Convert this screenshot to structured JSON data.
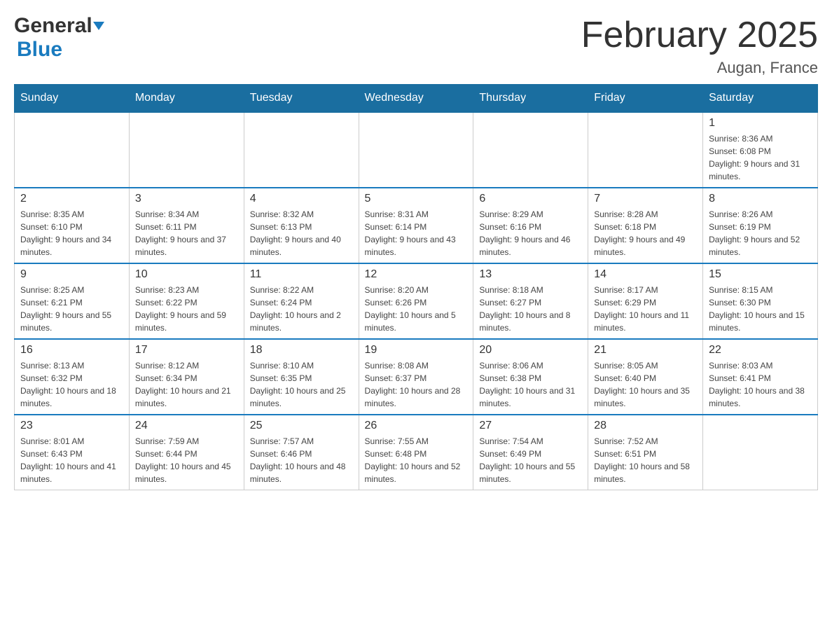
{
  "header": {
    "logo_general": "General",
    "logo_blue": "Blue",
    "month_title": "February 2025",
    "location": "Augan, France"
  },
  "days_of_week": [
    "Sunday",
    "Monday",
    "Tuesday",
    "Wednesday",
    "Thursday",
    "Friday",
    "Saturday"
  ],
  "weeks": [
    [
      {
        "day": "",
        "info": ""
      },
      {
        "day": "",
        "info": ""
      },
      {
        "day": "",
        "info": ""
      },
      {
        "day": "",
        "info": ""
      },
      {
        "day": "",
        "info": ""
      },
      {
        "day": "",
        "info": ""
      },
      {
        "day": "1",
        "info": "Sunrise: 8:36 AM\nSunset: 6:08 PM\nDaylight: 9 hours and 31 minutes."
      }
    ],
    [
      {
        "day": "2",
        "info": "Sunrise: 8:35 AM\nSunset: 6:10 PM\nDaylight: 9 hours and 34 minutes."
      },
      {
        "day": "3",
        "info": "Sunrise: 8:34 AM\nSunset: 6:11 PM\nDaylight: 9 hours and 37 minutes."
      },
      {
        "day": "4",
        "info": "Sunrise: 8:32 AM\nSunset: 6:13 PM\nDaylight: 9 hours and 40 minutes."
      },
      {
        "day": "5",
        "info": "Sunrise: 8:31 AM\nSunset: 6:14 PM\nDaylight: 9 hours and 43 minutes."
      },
      {
        "day": "6",
        "info": "Sunrise: 8:29 AM\nSunset: 6:16 PM\nDaylight: 9 hours and 46 minutes."
      },
      {
        "day": "7",
        "info": "Sunrise: 8:28 AM\nSunset: 6:18 PM\nDaylight: 9 hours and 49 minutes."
      },
      {
        "day": "8",
        "info": "Sunrise: 8:26 AM\nSunset: 6:19 PM\nDaylight: 9 hours and 52 minutes."
      }
    ],
    [
      {
        "day": "9",
        "info": "Sunrise: 8:25 AM\nSunset: 6:21 PM\nDaylight: 9 hours and 55 minutes."
      },
      {
        "day": "10",
        "info": "Sunrise: 8:23 AM\nSunset: 6:22 PM\nDaylight: 9 hours and 59 minutes."
      },
      {
        "day": "11",
        "info": "Sunrise: 8:22 AM\nSunset: 6:24 PM\nDaylight: 10 hours and 2 minutes."
      },
      {
        "day": "12",
        "info": "Sunrise: 8:20 AM\nSunset: 6:26 PM\nDaylight: 10 hours and 5 minutes."
      },
      {
        "day": "13",
        "info": "Sunrise: 8:18 AM\nSunset: 6:27 PM\nDaylight: 10 hours and 8 minutes."
      },
      {
        "day": "14",
        "info": "Sunrise: 8:17 AM\nSunset: 6:29 PM\nDaylight: 10 hours and 11 minutes."
      },
      {
        "day": "15",
        "info": "Sunrise: 8:15 AM\nSunset: 6:30 PM\nDaylight: 10 hours and 15 minutes."
      }
    ],
    [
      {
        "day": "16",
        "info": "Sunrise: 8:13 AM\nSunset: 6:32 PM\nDaylight: 10 hours and 18 minutes."
      },
      {
        "day": "17",
        "info": "Sunrise: 8:12 AM\nSunset: 6:34 PM\nDaylight: 10 hours and 21 minutes."
      },
      {
        "day": "18",
        "info": "Sunrise: 8:10 AM\nSunset: 6:35 PM\nDaylight: 10 hours and 25 minutes."
      },
      {
        "day": "19",
        "info": "Sunrise: 8:08 AM\nSunset: 6:37 PM\nDaylight: 10 hours and 28 minutes."
      },
      {
        "day": "20",
        "info": "Sunrise: 8:06 AM\nSunset: 6:38 PM\nDaylight: 10 hours and 31 minutes."
      },
      {
        "day": "21",
        "info": "Sunrise: 8:05 AM\nSunset: 6:40 PM\nDaylight: 10 hours and 35 minutes."
      },
      {
        "day": "22",
        "info": "Sunrise: 8:03 AM\nSunset: 6:41 PM\nDaylight: 10 hours and 38 minutes."
      }
    ],
    [
      {
        "day": "23",
        "info": "Sunrise: 8:01 AM\nSunset: 6:43 PM\nDaylight: 10 hours and 41 minutes."
      },
      {
        "day": "24",
        "info": "Sunrise: 7:59 AM\nSunset: 6:44 PM\nDaylight: 10 hours and 45 minutes."
      },
      {
        "day": "25",
        "info": "Sunrise: 7:57 AM\nSunset: 6:46 PM\nDaylight: 10 hours and 48 minutes."
      },
      {
        "day": "26",
        "info": "Sunrise: 7:55 AM\nSunset: 6:48 PM\nDaylight: 10 hours and 52 minutes."
      },
      {
        "day": "27",
        "info": "Sunrise: 7:54 AM\nSunset: 6:49 PM\nDaylight: 10 hours and 55 minutes."
      },
      {
        "day": "28",
        "info": "Sunrise: 7:52 AM\nSunset: 6:51 PM\nDaylight: 10 hours and 58 minutes."
      },
      {
        "day": "",
        "info": ""
      }
    ]
  ]
}
